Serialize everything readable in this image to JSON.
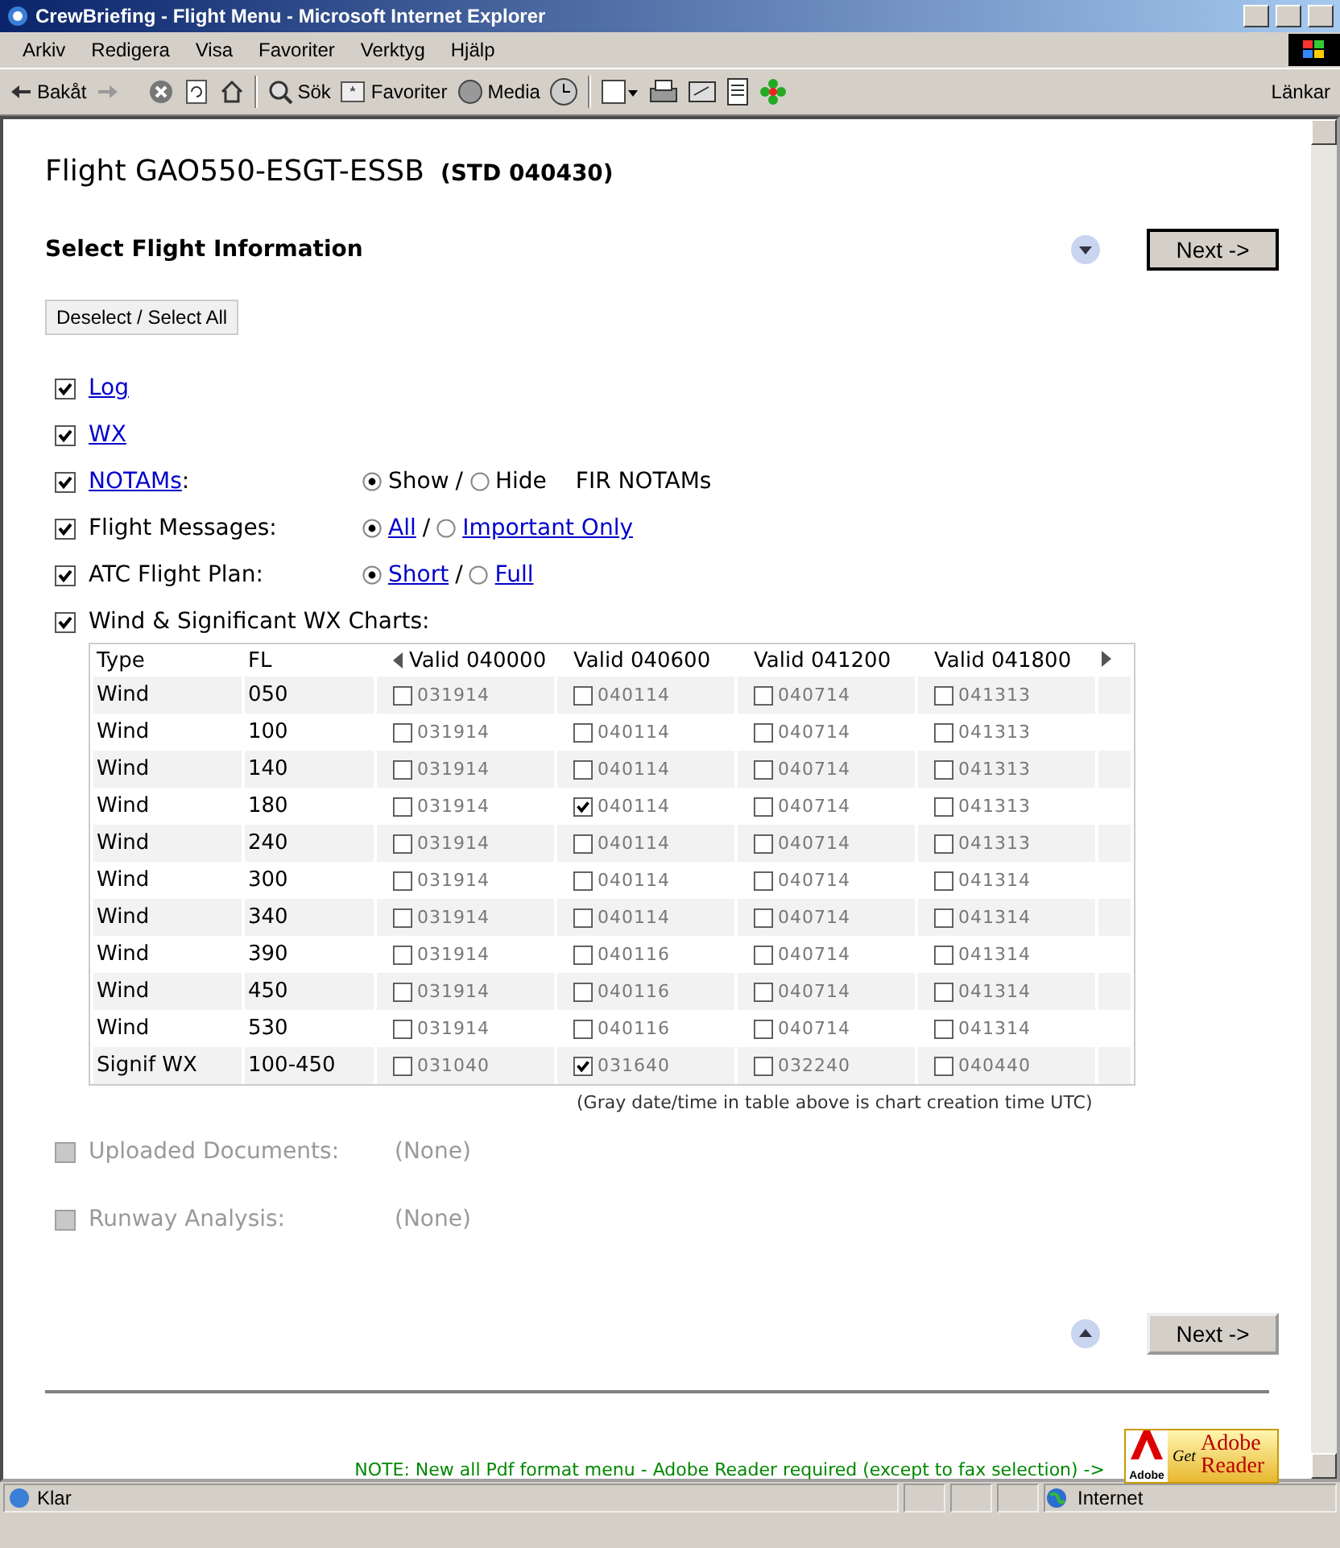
{
  "window": {
    "title": "CrewBriefing - Flight Menu - Microsoft Internet Explorer"
  },
  "menu": [
    "Arkiv",
    "Redigera",
    "Visa",
    "Favoriter",
    "Verktyg",
    "Hjälp"
  ],
  "toolbar": {
    "back": "Bakåt",
    "search": "Sök",
    "favorites": "Favoriter",
    "media": "Media",
    "links": "Länkar"
  },
  "page": {
    "heading": "Flight GAO550-ESGT-ESSB",
    "std": "(STD 040430)",
    "section_title": "Select Flight Information",
    "next_top": "Next ->",
    "deselect_button": "Deselect / Select All",
    "options": [
      {
        "kind": "link",
        "label": "Log",
        "checked": true
      },
      {
        "kind": "link",
        "label": "WX",
        "checked": true
      },
      {
        "kind": "radio",
        "label": "NOTAMs",
        "label_link": true,
        "suffix": ":",
        "checked": true,
        "separator": "/",
        "radios": [
          {
            "label": "Show",
            "link": false,
            "selected": true
          },
          {
            "label": "Hide",
            "link": false,
            "selected": false
          }
        ],
        "note": "FIR NOTAMs"
      },
      {
        "kind": "radio",
        "label": "Flight Messages:",
        "label_link": false,
        "checked": true,
        "separator": "/",
        "radios": [
          {
            "label": "All",
            "link": true,
            "selected": true
          },
          {
            "label": "Important Only",
            "link": true,
            "selected": false
          }
        ]
      },
      {
        "kind": "radio",
        "label": "ATC Flight Plan:",
        "label_link": false,
        "checked": true,
        "separator": "/",
        "radios": [
          {
            "label": "Short",
            "link": true,
            "selected": true
          },
          {
            "label": "Full",
            "link": true,
            "selected": false
          }
        ]
      },
      {
        "kind": "plain",
        "label": "Wind & Significant WX Charts:",
        "checked": true
      }
    ],
    "charts_table": {
      "columns": [
        "Type",
        "FL",
        "Valid 040000",
        "Valid 040600",
        "Valid 041200",
        "Valid 041800"
      ],
      "rows": [
        {
          "cells": [
            {
              "text": "Wind"
            },
            {
              "text": "050"
            },
            {
              "text": "031914",
              "checked": false
            },
            {
              "text": "040114",
              "checked": false
            },
            {
              "text": "040714",
              "checked": false
            },
            {
              "text": "041313",
              "checked": false
            }
          ]
        },
        {
          "cells": [
            {
              "text": "Wind"
            },
            {
              "text": "100"
            },
            {
              "text": "031914",
              "checked": false
            },
            {
              "text": "040114",
              "checked": false
            },
            {
              "text": "040714",
              "checked": false
            },
            {
              "text": "041313",
              "checked": false
            }
          ]
        },
        {
          "cells": [
            {
              "text": "Wind"
            },
            {
              "text": "140"
            },
            {
              "text": "031914",
              "checked": false
            },
            {
              "text": "040114",
              "checked": false
            },
            {
              "text": "040714",
              "checked": false
            },
            {
              "text": "041313",
              "checked": false
            }
          ]
        },
        {
          "cells": [
            {
              "text": "Wind"
            },
            {
              "text": "180"
            },
            {
              "text": "031914",
              "checked": false
            },
            {
              "text": "040114",
              "checked": true
            },
            {
              "text": "040714",
              "checked": false
            },
            {
              "text": "041313",
              "checked": false
            }
          ]
        },
        {
          "cells": [
            {
              "text": "Wind"
            },
            {
              "text": "240"
            },
            {
              "text": "031914",
              "checked": false
            },
            {
              "text": "040114",
              "checked": false
            },
            {
              "text": "040714",
              "checked": false
            },
            {
              "text": "041313",
              "checked": false
            }
          ]
        },
        {
          "cells": [
            {
              "text": "Wind"
            },
            {
              "text": "300"
            },
            {
              "text": "031914",
              "checked": false
            },
            {
              "text": "040114",
              "checked": false
            },
            {
              "text": "040714",
              "checked": false
            },
            {
              "text": "041314",
              "checked": false
            }
          ]
        },
        {
          "cells": [
            {
              "text": "Wind"
            },
            {
              "text": "340"
            },
            {
              "text": "031914",
              "checked": false
            },
            {
              "text": "040114",
              "checked": false
            },
            {
              "text": "040714",
              "checked": false
            },
            {
              "text": "041314",
              "checked": false
            }
          ]
        },
        {
          "cells": [
            {
              "text": "Wind"
            },
            {
              "text": "390"
            },
            {
              "text": "031914",
              "checked": false
            },
            {
              "text": "040116",
              "checked": false
            },
            {
              "text": "040714",
              "checked": false
            },
            {
              "text": "041314",
              "checked": false
            }
          ]
        },
        {
          "cells": [
            {
              "text": "Wind"
            },
            {
              "text": "450"
            },
            {
              "text": "031914",
              "checked": false
            },
            {
              "text": "040116",
              "checked": false
            },
            {
              "text": "040714",
              "checked": false
            },
            {
              "text": "041314",
              "checked": false
            }
          ]
        },
        {
          "cells": [
            {
              "text": "Wind"
            },
            {
              "text": "530"
            },
            {
              "text": "031914",
              "checked": false
            },
            {
              "text": "040116",
              "checked": false
            },
            {
              "text": "040714",
              "checked": false
            },
            {
              "text": "041314",
              "checked": false
            }
          ]
        },
        {
          "cells": [
            {
              "text": "Signif WX"
            },
            {
              "text": "100-450"
            },
            {
              "text": "031040",
              "checked": false
            },
            {
              "text": "031640",
              "checked": true
            },
            {
              "text": "032240",
              "checked": false
            },
            {
              "text": "040440",
              "checked": false
            }
          ]
        }
      ],
      "footnote": "(Gray date/time in table above is chart creation time UTC)"
    },
    "extra_options": [
      {
        "label": "Uploaded Documents:",
        "value": "(None)",
        "disabled": true
      },
      {
        "label": "Runway Analysis:",
        "value": "(None)",
        "disabled": true
      }
    ],
    "next_bottom": "Next ->",
    "note": "NOTE: New all Pdf format menu - Adobe Reader required (except to fax selection) ->",
    "adobe_badge": {
      "get": "Get",
      "brand": "Adobe",
      "product_top": "Adobe",
      "product_bottom": "Reader"
    }
  },
  "status_bar": {
    "status": "Klar",
    "zone": "Internet"
  }
}
